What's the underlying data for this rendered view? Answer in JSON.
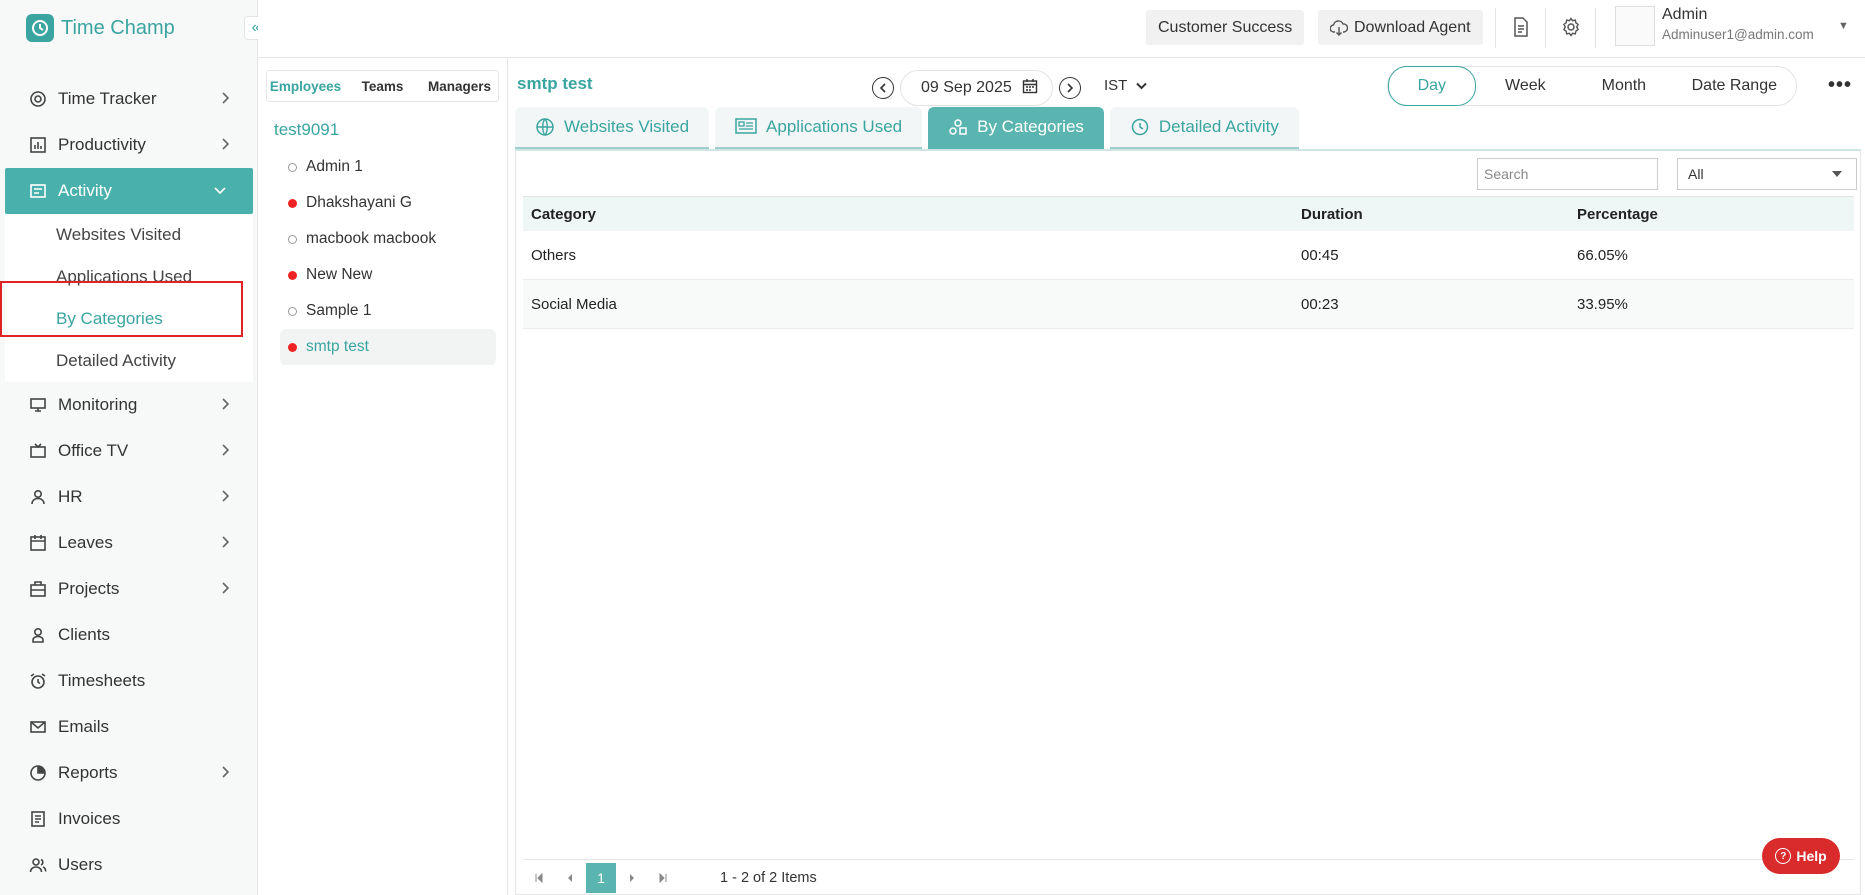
{
  "app": {
    "name": "Time Champ"
  },
  "sidebar": {
    "items": [
      {
        "label": "Time Tracker",
        "icon": "time-tracker-icon",
        "expandable": true
      },
      {
        "label": "Productivity",
        "icon": "bar-chart-icon",
        "expandable": true
      },
      {
        "label": "Activity",
        "icon": "activity-icon",
        "expandable": true,
        "active": true
      },
      {
        "label": "Monitoring",
        "icon": "monitor-icon",
        "expandable": true
      },
      {
        "label": "Office TV",
        "icon": "tv-icon",
        "expandable": true
      },
      {
        "label": "HR",
        "icon": "person-icon",
        "expandable": true
      },
      {
        "label": "Leaves",
        "icon": "calendar-icon",
        "expandable": true
      },
      {
        "label": "Projects",
        "icon": "briefcase-icon",
        "expandable": true
      },
      {
        "label": "Clients",
        "icon": "client-icon",
        "expandable": false
      },
      {
        "label": "Timesheets",
        "icon": "alarm-clock-icon",
        "expandable": false
      },
      {
        "label": "Emails",
        "icon": "mail-icon",
        "expandable": false
      },
      {
        "label": "Reports",
        "icon": "pie-chart-icon",
        "expandable": true
      },
      {
        "label": "Invoices",
        "icon": "invoice-icon",
        "expandable": false
      },
      {
        "label": "Users",
        "icon": "users-icon",
        "expandable": false
      }
    ],
    "activity_subitems": [
      {
        "label": "Websites Visited"
      },
      {
        "label": "Applications Used"
      },
      {
        "label": "By Categories",
        "active": true
      },
      {
        "label": "Detailed Activity"
      }
    ]
  },
  "topbar": {
    "customer_success": "Customer Success",
    "download_agent": "Download Agent",
    "user": {
      "name": "Admin",
      "email": "Adminuser1@admin.com"
    }
  },
  "employees": {
    "tabs": [
      "Employees",
      "Teams",
      "Managers"
    ],
    "active_tab": "Employees",
    "group": "test9091",
    "list": [
      {
        "name": "Admin 1",
        "online": false
      },
      {
        "name": "Dhakshayani G",
        "online": true
      },
      {
        "name": "macbook macbook",
        "online": false
      },
      {
        "name": "New New",
        "online": true
      },
      {
        "name": "Sample 1",
        "online": false
      },
      {
        "name": "smtp test",
        "online": true,
        "selected": true
      }
    ]
  },
  "main": {
    "employee_title": "smtp test",
    "date": "09 Sep 2025",
    "timezone": "IST",
    "periods": [
      "Day",
      "Week",
      "Month",
      "Date Range"
    ],
    "active_period": "Day",
    "tabs": [
      {
        "label": "Websites Visited",
        "icon": "globe-icon"
      },
      {
        "label": "Applications Used",
        "icon": "apps-icon"
      },
      {
        "label": "By Categories",
        "icon": "categories-icon",
        "active": true
      },
      {
        "label": "Detailed Activity",
        "icon": "history-icon"
      }
    ],
    "search_placeholder": "Search",
    "filter_value": "All",
    "table": {
      "columns": [
        "Category",
        "Duration",
        "Percentage"
      ],
      "rows": [
        [
          "Others",
          "00:45",
          "66.05%"
        ],
        [
          "Social Media",
          "00:23",
          "33.95%"
        ]
      ]
    },
    "pager": {
      "current_page": "1",
      "info": "1 - 2 of 2 Items"
    },
    "help_label": "Help"
  },
  "colors": {
    "accent": "#3aa5a0",
    "active_bg": "#4ab0ab",
    "help": "#d92b2b",
    "online_dot": "#e22222"
  }
}
